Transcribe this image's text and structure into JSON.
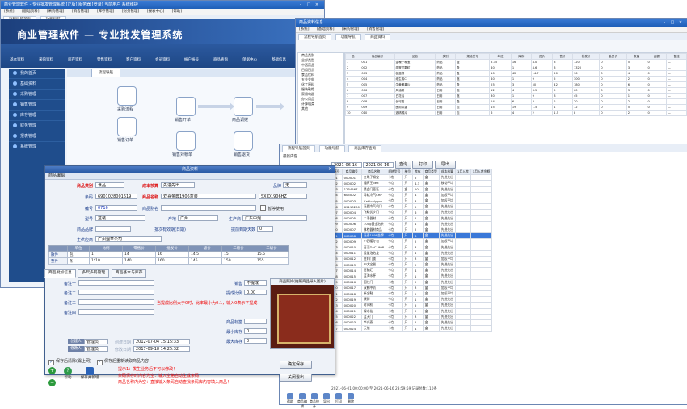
{
  "main_window": {
    "title": "商业管理软件 - 专业批发管理系统 [正版] 服务器 [登录] 当前用户 系统维护",
    "menus": [
      "[系统]",
      "[基础资料]",
      "[采购管理]",
      "[销售管理]",
      "[库存管理]",
      "[财务管理]",
      "[报表中心]",
      "[帮助]"
    ],
    "tabs": [
      "流程导航首页",
      "功能导航"
    ],
    "brand": "商业管理软件 — 专业批发管理系统",
    "toolbar": [
      {
        "label": "基本资料",
        "color": "#e8a12b"
      },
      {
        "label": "采购资料",
        "color": "#d84a3a"
      },
      {
        "label": "库存资料",
        "color": "#33a0d8"
      },
      {
        "label": "零售资料",
        "color": "#58b74a"
      },
      {
        "label": "客户资料",
        "color": "#e2c33b"
      },
      {
        "label": "会员资料",
        "color": "#c06ad8"
      },
      {
        "label": "帐户帐号",
        "color": "#3fc7b5"
      },
      {
        "label": "商品查询",
        "color": "#f07d3a"
      },
      {
        "label": "单据中心",
        "color": "#7aa0e8"
      },
      {
        "label": "基础信息",
        "color": "#c9d84a"
      }
    ],
    "side_menu": [
      "我的首页",
      "基础资料",
      "采购管理",
      "销售管理",
      "库存管理",
      "财务管理",
      "报表管理",
      "系统管理"
    ],
    "flow_tab": "流程导航",
    "flow_nodes": [
      "采购流程",
      "销售开单",
      "商品调拨",
      "销售订单",
      "销售对帐单",
      "销售退货"
    ]
  },
  "table_window": {
    "title": "商品资料信息",
    "tabs": [
      "流程导航首页",
      "功能导航",
      "商品资料"
    ],
    "tree_items": [
      "商品类别",
      "全部类型",
      "中西药品",
      "日用百货",
      "食品饮料",
      "五金交电",
      "化工原料",
      "服装鞋帽",
      "家用电器",
      "办公用品",
      "计算机类",
      "其他"
    ],
    "headers": [
      "选",
      "商品编号",
      "品名",
      "类别",
      "规格型号",
      "单位",
      "库存",
      "进价",
      "售价",
      "批发价",
      "会员价",
      "数量",
      "金额",
      "备注"
    ],
    "rows": [
      [
        "1",
        "001",
        "金嗓子喉宝",
        "药品",
        "盒",
        "5.35",
        "16",
        "4.0",
        "3",
        "120",
        "0",
        "5",
        "0",
        "—"
      ],
      [
        "2",
        "002",
        "感冒灵颗粒",
        "药品",
        "盒",
        "40",
        "1",
        "4.6",
        "3",
        "1320",
        "0",
        "3",
        "0",
        "—"
      ],
      [
        "3",
        "003",
        "板蓝根",
        "药品",
        "盒",
        "10",
        "42",
        "14.7",
        "20",
        "96",
        "0",
        "4",
        "0",
        "—"
      ],
      [
        "4",
        "004",
        "维生素C",
        "药品",
        "瓶",
        "40",
        "1",
        "9",
        "5",
        "300",
        "0",
        "2",
        "0",
        "—"
      ],
      [
        "5",
        "005",
        "牛黄解毒片",
        "药品",
        "盒",
        "25",
        "3",
        "50",
        "42",
        "180",
        "0",
        "6",
        "0",
        "—"
      ],
      [
        "6",
        "006",
        "风油精",
        "日用",
        "瓶",
        "12",
        "4",
        "6.5",
        "5",
        "60",
        "0",
        "3",
        "0",
        "—"
      ],
      [
        "7",
        "007",
        "白花油",
        "日用",
        "瓶",
        "30",
        "1",
        "9",
        "8",
        "45",
        "0",
        "1",
        "0",
        "—"
      ],
      [
        "8",
        "008",
        "创可贴",
        "日用",
        "盒",
        "14",
        "6",
        "3",
        "2",
        "20",
        "0",
        "2",
        "0",
        "—"
      ],
      [
        "9",
        "009",
        "医用口罩",
        "日用",
        "包",
        "15",
        "19",
        "1.5",
        "1",
        "12",
        "0",
        "5",
        "0",
        "—"
      ],
      [
        "10",
        "010",
        "酒精棉片",
        "日用",
        "包",
        "6",
        "4",
        "2",
        "1.5",
        "8",
        "0",
        "2",
        "0",
        "—"
      ]
    ]
  },
  "sales_window": {
    "tabs": [
      "流程导航首页",
      "功能导航",
      "商品库存查询"
    ],
    "filter_label": "最新内容",
    "date_from": "2021-06-16",
    "date_to": "2021-06-16",
    "query_btn": "查询",
    "print_btn": "打印",
    "export_btn": "导出",
    "headers": [
      "序号",
      "商品编号",
      "商品名称",
      "规格型号",
      "单位",
      "库存",
      "商品类型",
      "成本核算",
      "1月入库",
      "1月入库金额"
    ],
    "rows": [
      [
        "01",
        "000001",
        "金嗓子喉宝",
        "卡包",
        "只",
        "5",
        "盒",
        "先进先出",
        "",
        ""
      ],
      [
        "02",
        "000002",
        "通宵王belt",
        "卡包",
        "只",
        "4.3",
        "盒",
        "移动平均",
        "",
        ""
      ],
      [
        "03",
        "1234567",
        "晨会门签证",
        "卡包",
        "盒",
        "10",
        "盒",
        "先进先出",
        "",
        ""
      ],
      [
        "04",
        "605002",
        "导轨冷气CRP",
        "卡包",
        "只",
        "4",
        "盒",
        "加权平均",
        "",
        ""
      ],
      [
        "05",
        "000003",
        "Cablcolygon",
        "卡包",
        "只",
        "3",
        "盒",
        "加权平均",
        "",
        ""
      ],
      [
        "06",
        "69110200",
        "泛圆冷气机门",
        "卡包",
        "只",
        "5",
        "盒",
        "先进先出",
        "",
        ""
      ],
      [
        "07",
        "000004",
        "飞碟优步门",
        "卡包",
        "只",
        "6",
        "盒",
        "先进先出",
        "",
        ""
      ],
      [
        "08",
        "000005",
        "二手器材",
        "卡包",
        "只",
        "2",
        "盒",
        "先进先出",
        "",
        ""
      ],
      [
        "09",
        "000006",
        "100g黄金泡茶",
        "卡包",
        "只",
        "1",
        "盒",
        "先进先出",
        "",
        ""
      ],
      [
        "10",
        "000007",
        "体检器材商品",
        "卡包",
        "只",
        "2",
        "盒",
        "先进先出",
        "",
        ""
      ],
      [
        "11",
        "000008",
        "泛泰1998金牌",
        "卡包",
        "只",
        "8",
        "盒",
        "先进先出",
        "",
        ""
      ],
      [
        "12",
        "000009",
        "小西暖冬包",
        "卡包",
        "只",
        "2",
        "盒",
        "加权平均",
        "",
        ""
      ],
      [
        "13",
        "000010",
        "百汇DAC1998",
        "卡包",
        "只",
        "3",
        "盒",
        "先进先出",
        "",
        ""
      ],
      [
        "14",
        "000011",
        "重量泡泡龙",
        "卡包",
        "只",
        "1",
        "盒",
        "先进先出",
        "",
        ""
      ],
      [
        "15",
        "000012",
        "胜利门锁",
        "卡包",
        "只",
        "3",
        "盒",
        "加权平均",
        "",
        ""
      ],
      [
        "16",
        "000013",
        "中大宝器",
        "卡包",
        "只",
        "2",
        "盒",
        "先进先出",
        "",
        ""
      ],
      [
        "17",
        "000014",
        "百脑汇",
        "卡包",
        "只",
        "4",
        "盒",
        "先进先出",
        "",
        ""
      ],
      [
        "18",
        "000015",
        "蓝海水杯",
        "卡包",
        "只",
        "1",
        "盒",
        "先进先出",
        "",
        ""
      ],
      [
        "19",
        "000016",
        "国仁门",
        "卡包",
        "只",
        "2",
        "盒",
        "先进先出",
        "",
        ""
      ],
      [
        "20",
        "000017",
        "双鹤中药",
        "卡包",
        "只",
        "3",
        "盒",
        "加权平均",
        "",
        ""
      ],
      [
        "21",
        "000018",
        "新宝鞋",
        "卡包",
        "只",
        "2",
        "盒",
        "加权平均",
        "",
        ""
      ],
      [
        "22",
        "000019",
        "康牌",
        "卡包",
        "只",
        "1",
        "盒",
        "先进先出",
        "",
        ""
      ],
      [
        "23",
        "000020",
        "时间机",
        "卡包",
        "只",
        "5",
        "盒",
        "先进先出",
        "",
        ""
      ],
      [
        "24",
        "000021",
        "绿水仙",
        "卡包",
        "只",
        "2",
        "盒",
        "先进先出",
        "",
        ""
      ],
      [
        "25",
        "000022",
        "蓝天门",
        "卡包",
        "只",
        "3",
        "盒",
        "先进先出",
        "",
        ""
      ],
      [
        "26",
        "000023",
        "华兴泰",
        "卡包",
        "只",
        "2",
        "盒",
        "先进先出",
        "",
        ""
      ],
      [
        "27",
        "000024",
        "天旭",
        "卡包",
        "只",
        "4",
        "盒",
        "先进先出",
        "",
        ""
      ]
    ],
    "selected_row": 10,
    "status": "2021-06-01 00:00:00 至 2021-06-16 23:59:59 记录总数:110条",
    "bottom_buttons": [
      "帮助",
      "商品编辑",
      "商品统计",
      "导出",
      "打印",
      "删除"
    ]
  },
  "dialog": {
    "title": "商品资料",
    "section": "商品编辑",
    "category_label": "商品类别",
    "category_value": "食品",
    "cost_label": "成本核算",
    "cost_value": "先进先出",
    "brand_label": "品牌",
    "brand_value": "无",
    "barcode_label": "条码",
    "barcode_value": "6901028001619",
    "name_label": "商品名称",
    "name_value": "双喜金典1906盒装",
    "code_value": "SXJD1906HZ",
    "code_label": "编号",
    "code_no": "0716",
    "alias_label": "商品别名",
    "stop_label": "暂停使用",
    "model_label": "型号",
    "model_value": "盒装",
    "origin_label": "产地",
    "origin_value": "广州",
    "maker_label": "生产商",
    "maker_value": "广东中烟",
    "brand2_label": "商品品牌",
    "spec_label": "批次有效期(日期)",
    "warn_days_label": "提前到期天数",
    "warn_days_value": "0",
    "supplier_label": "主供应商",
    "supplier_value": "广州烟草公司",
    "unit_headers": [
      "单位",
      "比例",
      "零售价",
      "批发价",
      "一级价",
      "二级价",
      "三级价",
      "进价"
    ],
    "unit_rows": [
      {
        "label": "散件",
        "unit": "包",
        "ratio": "1",
        "p1": "14",
        "p2": "16",
        "p3": "14.5",
        "p4": "15",
        "p5": "15.5",
        "p6": "0"
      },
      {
        "label": "整件",
        "unit": "条",
        "ratio": "10",
        "ratio_text": "1*10",
        "p1": "140",
        "p2": "160",
        "p3": "145",
        "p4": "150",
        "p5": "155",
        "p6": "160"
      }
    ],
    "sub_tabs": [
      "商品附加信息",
      "多尺多码管理",
      "商品基本与库存"
    ],
    "note_labels": [
      "备注一",
      "备注二",
      "备注三",
      "备注四",
      "备注五"
    ],
    "extra_labels": {
      "sale_mode": "销售",
      "min_sale": "提成比例",
      "split_label": "商品标签",
      "min_stock": "最小库存",
      "max_stock": "最大库存"
    },
    "sale_mode_value": "不提成",
    "min_sale_value": "0.00",
    "min_stock_value": "0",
    "max_stock_value": "0",
    "price_note": "当提成比例大于0时，比率最小为0.1，输入0表示不提成",
    "photo_title": "商品照片(拍照商品导入图片)",
    "creator_label": "创建人",
    "creator_value": "管理员",
    "create_time_label": "创建日期",
    "create_time_value": "2012-07-04 15:15:33",
    "editor_label": "修改人",
    "editor_value": "管理员",
    "edit_time_label": "修改日期",
    "edit_time_value": "2017-09-18 14:25:32",
    "check1": "保存后清除(需上网)",
    "check2": "保存后重新读取商品内容",
    "help_btn": "帮助",
    "save_new_btn": "保存并新增",
    "tips": [
      "提示1：发生业务后不可以修改！",
      "条码保存时内容为空：输入空格自动生成条码！",
      "商品名称内为空：直接输入条码自动查找条码库内容填入商品！"
    ],
    "save_btn": "确定保存",
    "close_btn": "关闭退出"
  }
}
